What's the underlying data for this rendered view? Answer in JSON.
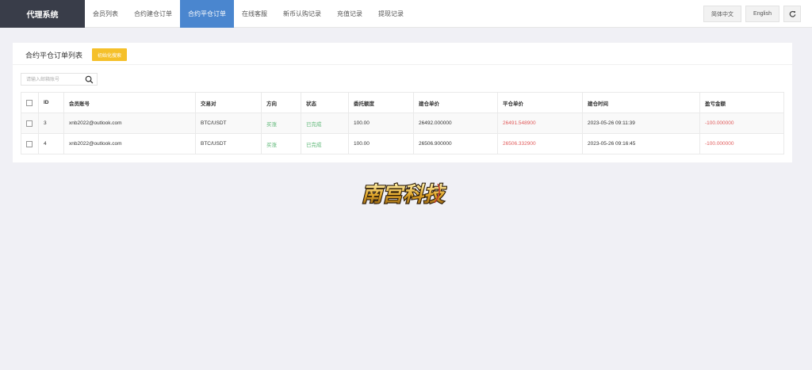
{
  "brand": "代理系统",
  "nav": [
    {
      "label": "会员列表",
      "active": false
    },
    {
      "label": "合约建仓订单",
      "active": false
    },
    {
      "label": "合约平仓订单",
      "active": true
    },
    {
      "label": "在线客服",
      "active": false
    },
    {
      "label": "新币认购记录",
      "active": false
    },
    {
      "label": "充值记录",
      "active": false
    },
    {
      "label": "提现记录",
      "active": false
    }
  ],
  "tools": {
    "lang_zh": "简体中文",
    "lang_en": "English",
    "refresh_icon": "refresh-icon"
  },
  "card": {
    "title": "合约平仓订单列表",
    "init_button": "初始化搜索"
  },
  "search": {
    "placeholder": "请输入邮箱账号",
    "icon": "search-icon"
  },
  "table": {
    "headers": [
      "ID",
      "会员账号",
      "交易对",
      "方向",
      "状态",
      "委托额度",
      "建仓单价",
      "平仓单价",
      "建仓时间",
      "盈亏金额"
    ],
    "rows": [
      [
        "3",
        "xnb2022@outlook.com",
        "BTC/USDT",
        "买涨",
        "已完成",
        "100.00",
        "26492.000000",
        "26491.548900",
        "2023-05-26 09:11:39",
        "-100.000000"
      ],
      [
        "4",
        "xnb2022@outlook.com",
        "BTC/USDT",
        "买涨",
        "已完成",
        "100.00",
        "26506.900000",
        "26506.332900",
        "2023-05-26 09:16:45",
        "-100.000000"
      ]
    ]
  },
  "colors": {
    "accent": "#4a86cf",
    "brand_bg": "#393d49",
    "warn": "#f5c02a",
    "profit_up": "#5fb878",
    "loss": "#e05a5a"
  },
  "logo": {
    "icon": "brand-logo-image",
    "text": "南宫科技"
  }
}
